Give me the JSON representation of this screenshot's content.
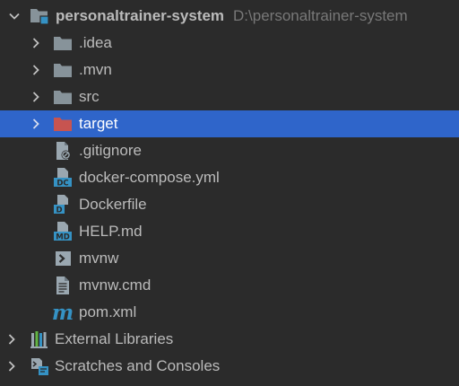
{
  "project_tree": {
    "root": {
      "name": "personaltrainer-system",
      "path": "D:\\personaltrainer-system",
      "icon": "module-folder-icon",
      "expanded": true
    },
    "items": [
      {
        "label": ".idea",
        "icon": "folder-icon",
        "expandable": true
      },
      {
        "label": ".mvn",
        "icon": "folder-icon",
        "expandable": true
      },
      {
        "label": "src",
        "icon": "folder-icon",
        "expandable": true
      },
      {
        "label": "target",
        "icon": "excluded-folder-icon",
        "expandable": true,
        "selected": true
      },
      {
        "label": ".gitignore",
        "icon": "ignore-file-icon",
        "expandable": false
      },
      {
        "label": "docker-compose.yml",
        "icon": "docker-compose-file-icon",
        "expandable": false
      },
      {
        "label": "Dockerfile",
        "icon": "dockerfile-icon",
        "expandable": false
      },
      {
        "label": "HELP.md",
        "icon": "markdown-file-icon",
        "expandable": false
      },
      {
        "label": "mvnw",
        "icon": "shell-script-icon",
        "expandable": false
      },
      {
        "label": "mvnw.cmd",
        "icon": "text-file-icon",
        "expandable": false
      },
      {
        "label": "pom.xml",
        "icon": "maven-icon",
        "expandable": false
      }
    ],
    "bottom": [
      {
        "label": "External Libraries",
        "icon": "external-libraries-icon",
        "expandable": true
      },
      {
        "label": "Scratches and Consoles",
        "icon": "scratches-icon",
        "expandable": true
      }
    ]
  },
  "colors": {
    "background": "#2b2b2b",
    "selection": "#2f65ca",
    "text": "#bbbbbb",
    "path_text": "#787878",
    "folder": "#87939a",
    "excluded_folder": "#c75450",
    "file_badge": "#3592c4"
  }
}
